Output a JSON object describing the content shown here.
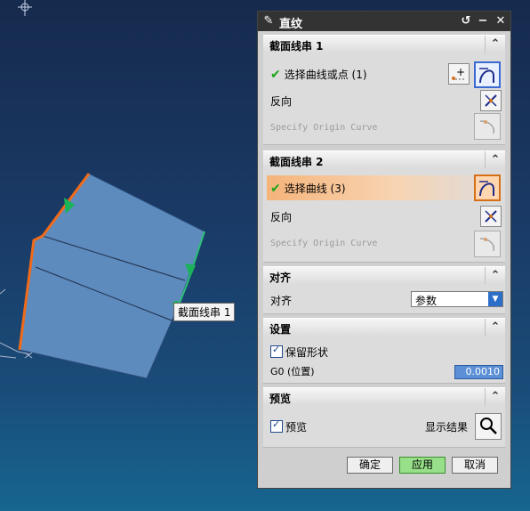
{
  "viewport": {
    "curve_label": "截面线串 1"
  },
  "dialog": {
    "title": "直纹",
    "section1": {
      "header": "截面线串 1",
      "select_label": "选择曲线或点 (1)",
      "reverse_label": "反向",
      "origin_label": "Specify Origin Curve"
    },
    "section2": {
      "header": "截面线串 2",
      "select_label": "选择曲线 (3)",
      "reverse_label": "反向",
      "origin_label": "Specify Origin Curve"
    },
    "alignment": {
      "header": "对齐",
      "label": "对齐",
      "value": "参数"
    },
    "settings": {
      "header": "设置",
      "keep_shape_label": "保留形状",
      "g0_label": "G0 (位置)",
      "g0_value": "0.0010"
    },
    "preview": {
      "header": "预览",
      "preview_label": "预览",
      "show_result_label": "显示结果"
    },
    "buttons": {
      "ok": "确定",
      "apply": "应用",
      "cancel": "取消"
    }
  },
  "colors": {
    "background_top": "#162a4d",
    "background_bottom": "#166690",
    "surface": "#5d8bbd",
    "edge_highlight": "#f06a1a",
    "edge_green": "#2ec07a",
    "dialog_titlebar": "#333333",
    "active_selection": "#f5b47a"
  }
}
